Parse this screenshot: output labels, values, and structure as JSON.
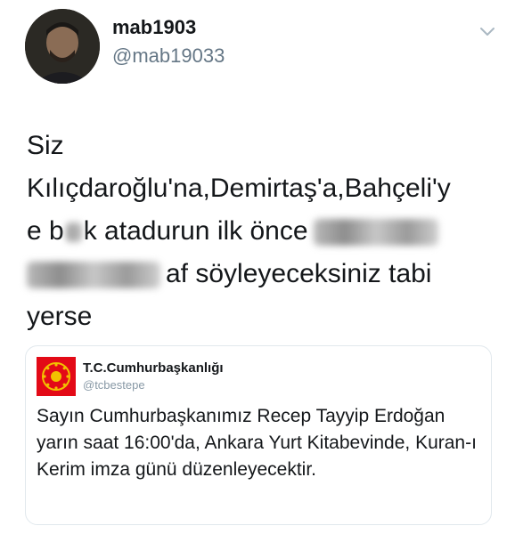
{
  "author": {
    "display_name": "mab1903",
    "handle": "@mab19033"
  },
  "tweet": {
    "line1": "Siz",
    "line2": "Kılıçdaroğlu'na,Demirtaş'a,Bahçeli'y",
    "line3_pre": "e b",
    "line3_mid": "k atadurun ilk önce",
    "line4_post": "af söyleyeceksiniz tabi",
    "line5": "yerse"
  },
  "quoted": {
    "display_name": "T.C.Cumhurbaşkanlığı",
    "handle": "@tcbestepe",
    "text": "Sayın Cumhurbaşkanımız Recep Tayyip Erdoğan yarın saat 16:00'da, Ankara Yurt Kitabevinde, Kuran-ı Kerim imza günü düzenleyecektir."
  },
  "colors": {
    "handle": "#657786",
    "border": "#e1e8ed",
    "seal_red": "#e30a17",
    "seal_gold": "#f2c200"
  },
  "icons": {
    "avatar": "user-avatar-icon",
    "menu": "chevron-down-icon",
    "seal": "presidential-seal-icon"
  }
}
